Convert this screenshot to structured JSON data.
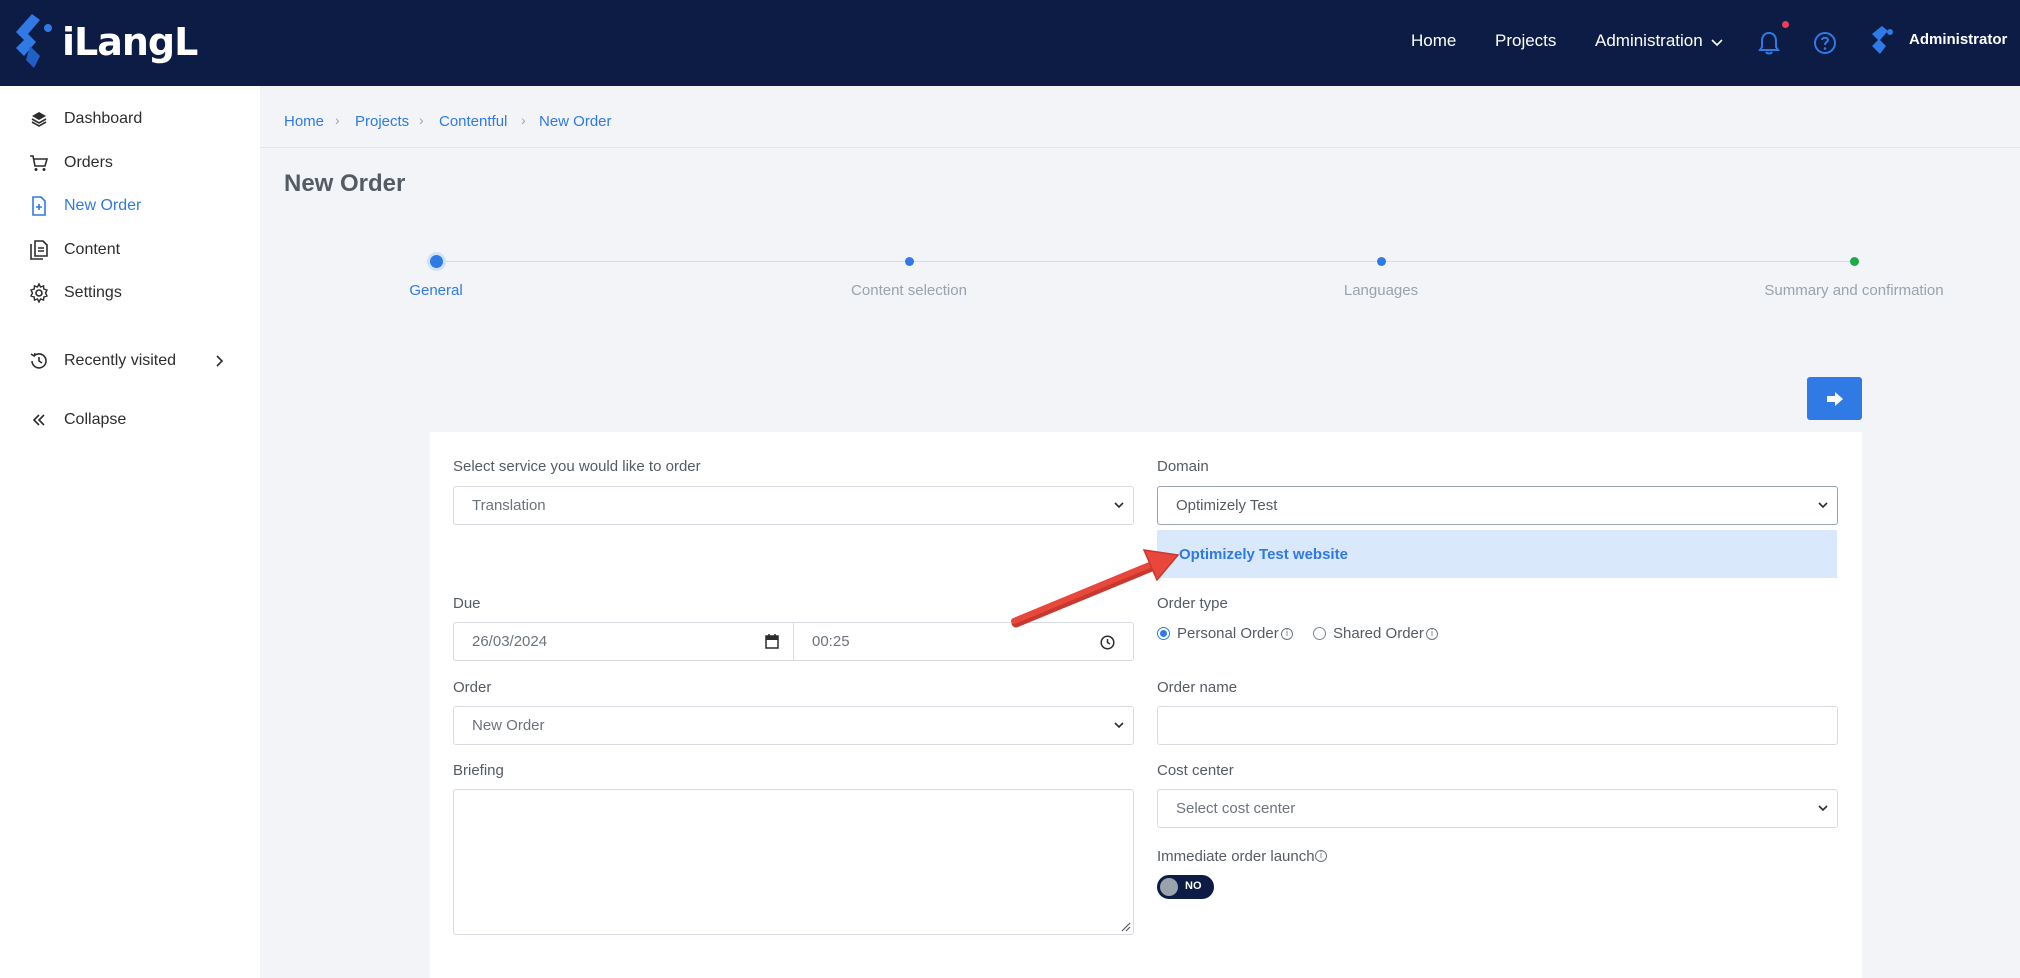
{
  "app": {
    "logo_text": "iLangL"
  },
  "topnav": {
    "home": "Home",
    "projects": "Projects",
    "administration": "Administration",
    "user_name": "Administrator"
  },
  "sidebar": {
    "items": [
      {
        "label": "Dashboard",
        "icon": "layers-icon"
      },
      {
        "label": "Orders",
        "icon": "cart-icon"
      },
      {
        "label": "New Order",
        "icon": "file-plus-icon",
        "active": true
      },
      {
        "label": "Content",
        "icon": "documents-icon"
      },
      {
        "label": "Settings",
        "icon": "gear-icon"
      }
    ],
    "recently_visited": "Recently visited",
    "collapse": "Collapse"
  },
  "breadcrumb": [
    "Home",
    "Projects",
    "Contentful",
    "New Order"
  ],
  "page_title": "New Order",
  "steps": [
    "General",
    "Content selection",
    "Languages",
    "Summary and confirmation"
  ],
  "form": {
    "service_label": "Select service you would like to order",
    "service_value": "Translation",
    "domain_label": "Domain",
    "domain_value": "Optimizely Test",
    "domain_option": "Optimizely Test website",
    "due_label": "Due",
    "due_date": "26/03/2024",
    "due_time": "00:25",
    "order_type_label": "Order type",
    "personal_order": "Personal Order",
    "shared_order": "Shared Order",
    "order_label": "Order",
    "order_value": "New Order",
    "order_name_label": "Order name",
    "order_name_value": "",
    "briefing_label": "Briefing",
    "briefing_value": "",
    "cost_center_label": "Cost center",
    "cost_center_placeholder": "Select cost center",
    "immediate_launch_label": "Immediate order launch",
    "immediate_launch_state": "NO"
  },
  "colors": {
    "topbar": "#0c1c44",
    "accent": "#2f7ae5",
    "final_step": "#1aaa4b",
    "annotation_arrow": "#e8483c"
  }
}
